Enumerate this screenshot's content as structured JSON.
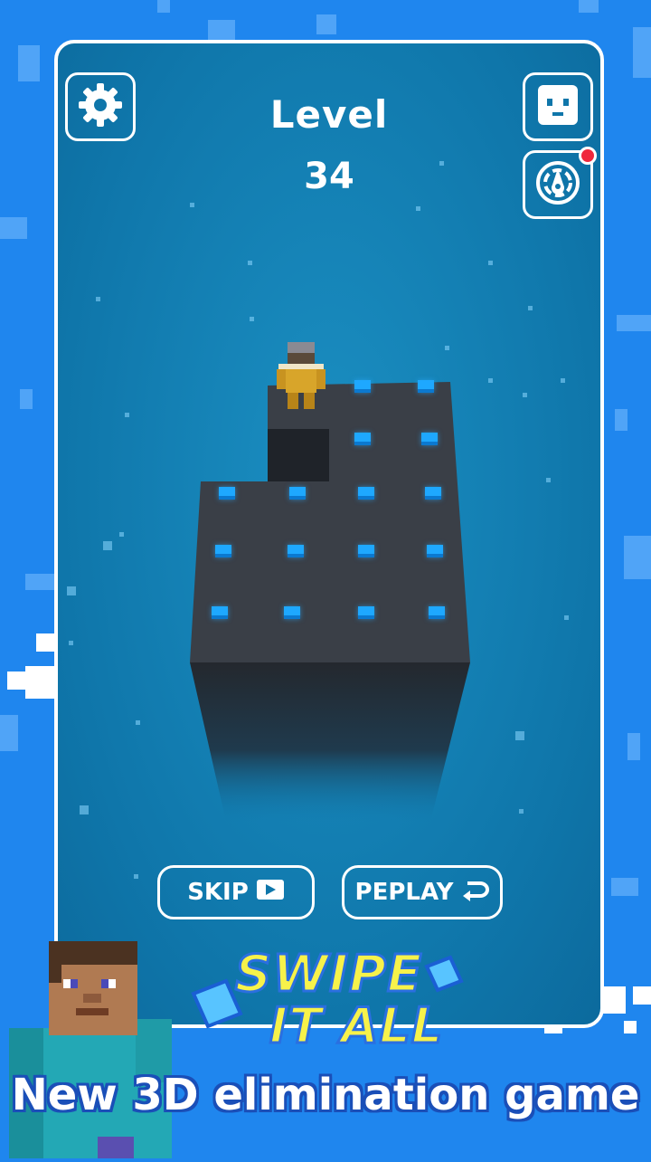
{
  "header": {
    "level_title": "Level",
    "level_number": "34"
  },
  "icons": {
    "settings": "gear-icon",
    "character": "face-icon",
    "wheel": "spin-wheel-icon"
  },
  "buttons": {
    "skip_label": "SKIP",
    "replay_label": "PEPLAY"
  },
  "promo": {
    "logo_line1": "SWIPE",
    "logo_line2": "IT ALL",
    "tagline": "New 3D elimination game"
  },
  "colors": {
    "background": "#1f86ee",
    "play_area": "#0f76aa",
    "block": "#3a3f47",
    "cube": "#1ea8ff",
    "logo_yellow": "#f7f24a",
    "notification": "#f0283c"
  }
}
